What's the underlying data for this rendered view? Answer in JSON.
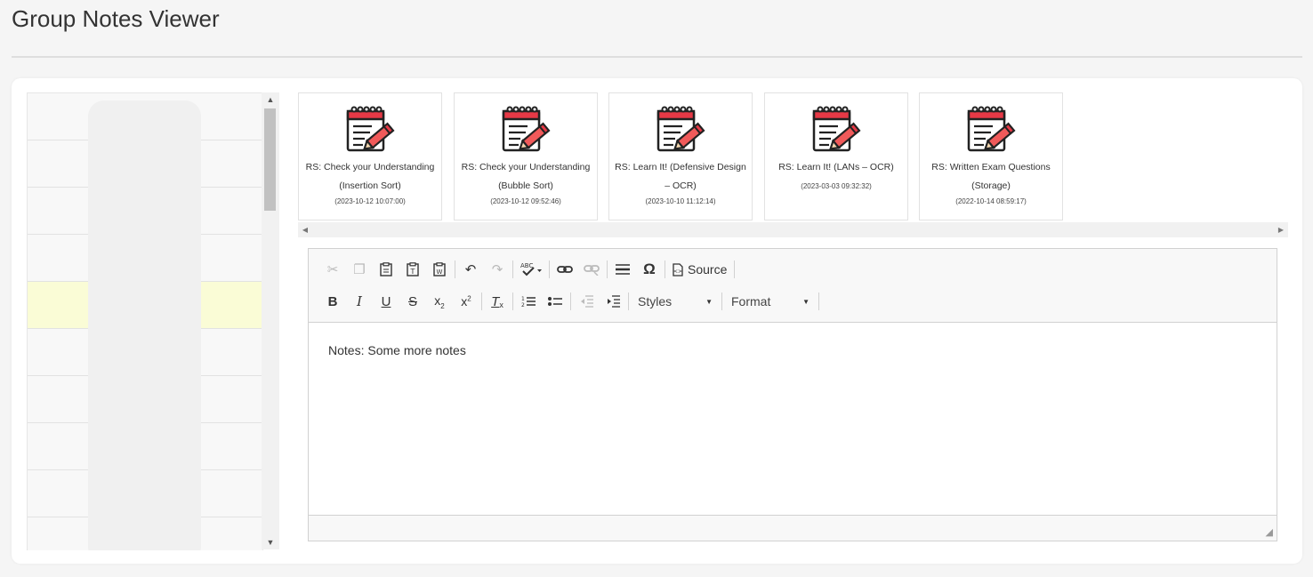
{
  "page": {
    "title": "Group Notes Viewer"
  },
  "list": {
    "row_count": 10,
    "selected_index": 4
  },
  "notes": [
    {
      "title_line1": "RS: Check your Understanding",
      "title_line2": "(Insertion Sort)",
      "date": "(2023-10-12 10:07:00)"
    },
    {
      "title_line1": "RS: Check your Understanding",
      "title_line2": "(Bubble Sort)",
      "date": "(2023-10-12 09:52:46)"
    },
    {
      "title_line1": "RS: Learn It! (Defensive Design",
      "title_line2": "– OCR)",
      "date": "(2023-10-10 11:12:14)"
    },
    {
      "title_line1": "RS: Learn It! (LANs – OCR)",
      "title_line2": "",
      "date": "(2023-03-03 09:32:32)"
    },
    {
      "title_line1": "RS: Written Exam Questions",
      "title_line2": "(Storage)",
      "date": "(2022-10-14 08:59:17)"
    }
  ],
  "toolbar": {
    "source_label": "Source",
    "styles_label": "Styles",
    "format_label": "Format"
  },
  "editor": {
    "content": "Notes: Some more notes"
  },
  "colors": {
    "selected_row": "#fafcd6",
    "icon_red": "#e63946",
    "icon_pencil": "#f05a5a"
  }
}
